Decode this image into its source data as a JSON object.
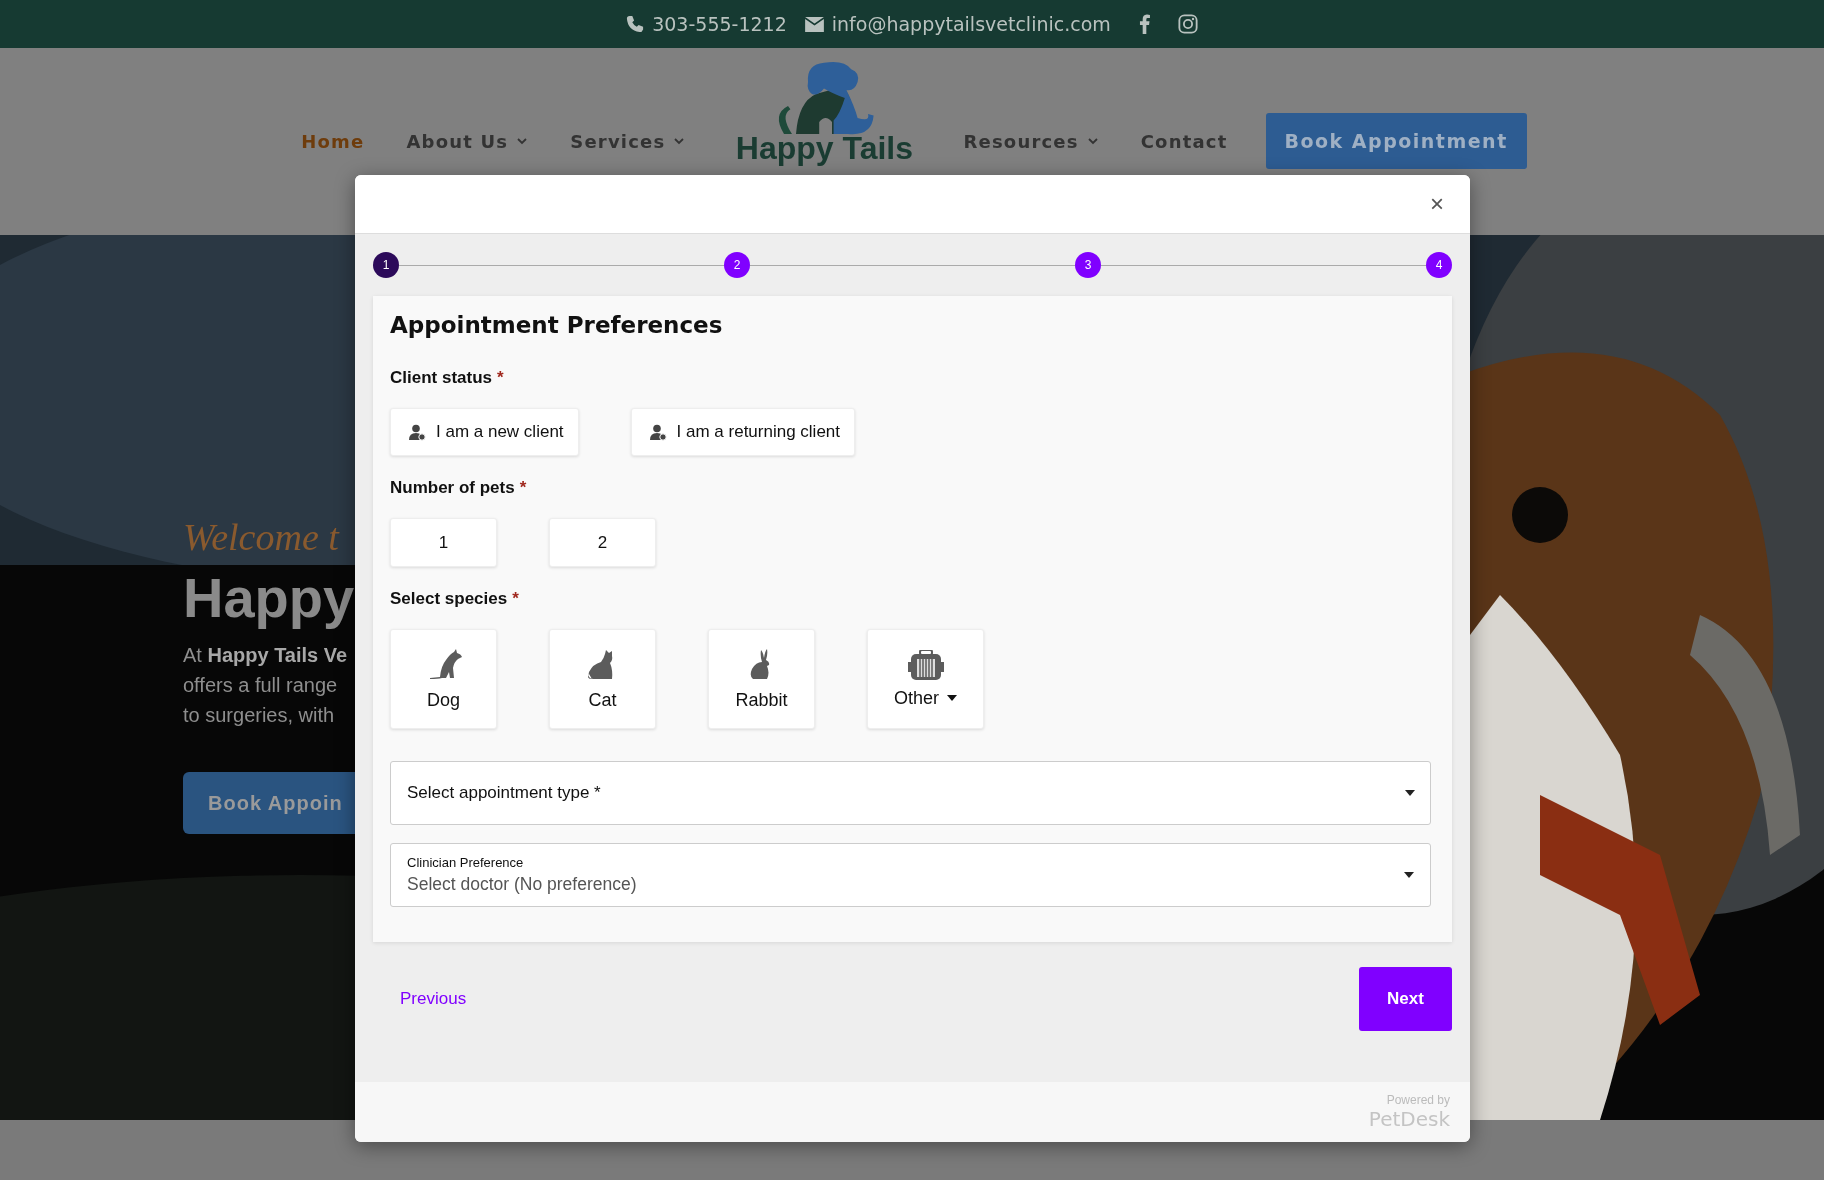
{
  "top_bar": {
    "phone": "303-555-1212",
    "email": "info@happytailsvetclinic.com"
  },
  "nav": {
    "items": [
      {
        "label": "Home",
        "selected": true,
        "dropdown": false
      },
      {
        "label": "About Us",
        "selected": false,
        "dropdown": true
      },
      {
        "label": "Services",
        "selected": false,
        "dropdown": true
      },
      {
        "label": "Resources",
        "selected": false,
        "dropdown": true
      },
      {
        "label": "Contact",
        "selected": false,
        "dropdown": false
      }
    ],
    "logo_text": "Happy Tails",
    "cta": "Book Appointment"
  },
  "hero": {
    "kicker": "Welcome t",
    "title": "Happy",
    "text": "At **Happy Tails Ve**\noffers a full range\nto surgeries, with",
    "button": "Book Appoin"
  },
  "modal": {
    "close": "×",
    "steps": [
      {
        "label": "1",
        "selected": true
      },
      {
        "label": "2",
        "selected": false
      },
      {
        "label": "3",
        "selected": false
      },
      {
        "label": "4",
        "selected": false
      }
    ],
    "title": "Appointment Preferences",
    "client_status": {
      "label": "Client status",
      "required": "*",
      "options": [
        {
          "label": "I am a new client",
          "selected": false
        },
        {
          "label": "I am a returning client",
          "selected": false
        }
      ]
    },
    "pets": {
      "label": "Number of pets",
      "required": "*",
      "options": [
        {
          "label": "1",
          "selected": false
        },
        {
          "label": "2",
          "selected": false
        }
      ]
    },
    "species": {
      "label": "Select species",
      "required": "*",
      "options": [
        {
          "label": "Dog",
          "kind": "dog",
          "selected": false
        },
        {
          "label": "Cat",
          "kind": "cat",
          "selected": false
        },
        {
          "label": "Rabbit",
          "kind": "rabbit",
          "selected": false
        },
        {
          "label": "Other",
          "kind": "other",
          "selected": false
        }
      ]
    },
    "appointment_type": {
      "placeholder": "Select appointment type *"
    },
    "clinician": {
      "label": "Clinician Preference",
      "value": "Select doctor (No preference)"
    },
    "previous": "Previous",
    "next": "Next",
    "powered_by": "Powered by",
    "brand": "PetDesk"
  }
}
